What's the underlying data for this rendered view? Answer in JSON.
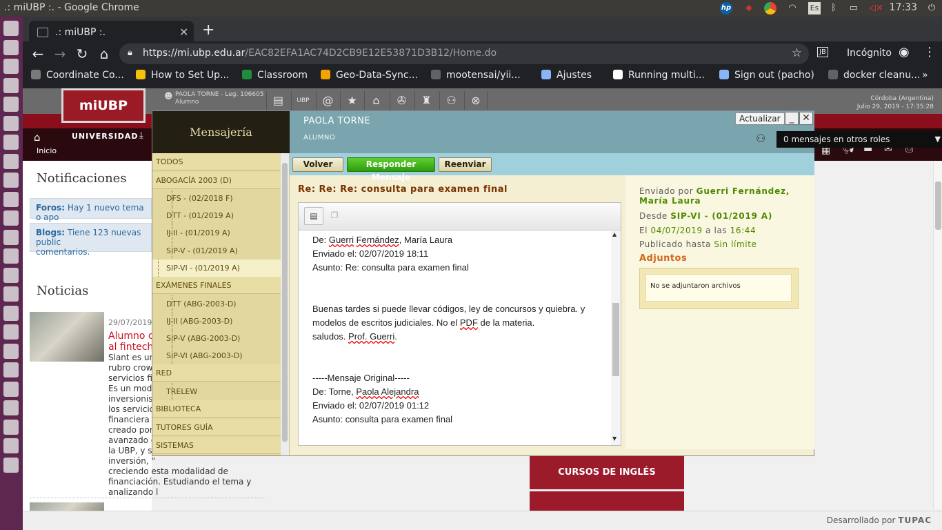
{
  "os": {
    "window_title": ".: miUBP :. - Google Chrome",
    "clock": "17:33",
    "keyboard": "Es",
    "dock_icons": [
      "settings-icon",
      "files-icon",
      "firefox-icon",
      "chrome-icon",
      "docs-icon",
      "amazon-icon",
      "calendar-icon",
      "store-icon",
      "image-icon",
      "presentation-icon",
      "spreadsheet-icon",
      "box-icon",
      "printer-icon",
      "vscode-icon",
      "cube-icon",
      "mail-icon",
      "hp-icon",
      "terminal-icon",
      "network-icon",
      "shield-icon",
      "word-icon",
      "usb-icon",
      "calc-icon",
      "trash-icon"
    ]
  },
  "browser": {
    "tab_title": ".: miUBP :.",
    "url_host": "https://mi.ubp.edu.ar",
    "url_path": "/EAC82EFA1AC74D2CB9E12E53871D3B12/Home.do",
    "incognito_label": "Incógnito",
    "extension_label": "JB",
    "bookmarks": [
      {
        "label": "Coordinate Co...",
        "color": "#7a7a7a"
      },
      {
        "label": "How to Set Up...",
        "color": "#f4c20d"
      },
      {
        "label": "Classroom",
        "color": "#1e8e3e"
      },
      {
        "label": "Geo-Data-Sync...",
        "color": "#f4a300"
      },
      {
        "label": "mootensai/yii...",
        "color": "#5f6368"
      },
      {
        "label": "Ajustes",
        "color": "#8ab4f8"
      },
      {
        "label": "Running multi...",
        "color": "#ffffff"
      },
      {
        "label": "Sign out (pacho)",
        "color": "#8ab4f8"
      },
      {
        "label": "docker cleanu...",
        "color": "#5f6368"
      }
    ]
  },
  "site": {
    "logo": "miUBP",
    "user_name": "PAOLA TORNE - Leg. 106605",
    "user_role": "Alumno",
    "location": "Córdoba (Argentina)",
    "datetime": "Julio 29, 2019 - 17:35:28",
    "nav_university": "UNIVERSIDAD",
    "nav_home": "Inicio",
    "notifications_title": "Notificaciones",
    "forum_label": "Foros:",
    "forum_text": "Hay 1 nuevo tema o apo",
    "blogs_label": "Blogs:",
    "blogs_text": "Tiene 123 nuevas public",
    "blogs_text2": "comentarios.",
    "news_title": "Noticias",
    "news_date": "29/07/2019",
    "news_headline1": "Alumno cr",
    "news_headline2": "al fintech",
    "news_lines": [
      "Slant es una",
      "rubro crowd",
      "servicios fin",
      "Es un model",
      "inversionist",
      "los servicios",
      "financiera t",
      "creado por",
      "avanzado d",
      "la UBP, y su",
      "inversión, \"",
      "creciendo esta modalidad de",
      "financiación. Estudiando el tema y",
      "analizando l"
    ],
    "banner_english": "CURSOS DE INGLÉS",
    "developed_by": "Desarrollado por",
    "developer": "TUPAC"
  },
  "messaging": {
    "title": "Mensajería",
    "sender_header_name": "PAOLA TORNE",
    "sender_header_role": "ALUMNO",
    "update_button": "Actualizar",
    "roles_select": "0  mensajes en otros roles",
    "buttons": {
      "back": "Volver",
      "reply": "Responder Mensaje",
      "forward": "Reenviar"
    },
    "folders": [
      {
        "label": "TODOS",
        "type": "cat"
      },
      {
        "label": "ABOGACÍA 2003 (D)",
        "type": "cat"
      },
      {
        "label": "DFS - (02/2018 F)",
        "type": "sub"
      },
      {
        "label": "DTT - (01/2019 A)",
        "type": "sub"
      },
      {
        "label": "IJ-II - (01/2019 A)",
        "type": "sub"
      },
      {
        "label": "SIP-V - (01/2019 A)",
        "type": "sub"
      },
      {
        "label": "SIP-VI - (01/2019 A)",
        "type": "sub",
        "selected": true
      },
      {
        "label": "EXÁMENES FINALES",
        "type": "cat"
      },
      {
        "label": "DTT (ABG-2003-D)",
        "type": "sub"
      },
      {
        "label": "IJ-II (ABG-2003-D)",
        "type": "sub"
      },
      {
        "label": "SIP-V (ABG-2003-D)",
        "type": "sub"
      },
      {
        "label": "SIP-VI (ABG-2003-D)",
        "type": "sub"
      },
      {
        "label": "RED",
        "type": "cat"
      },
      {
        "label": "TRELEW",
        "type": "sub"
      },
      {
        "label": "BIBLIOTECA",
        "type": "cat"
      },
      {
        "label": "TUTORES GUÍA",
        "type": "cat"
      },
      {
        "label": "SISTEMAS",
        "type": "cat"
      }
    ],
    "subject": "Re: Re: Re: consulta para examen final",
    "body": {
      "l1_pre": "De: ",
      "l1_a": "Guerri",
      "l1_sp": " ",
      "l1_b": "Fernández",
      "l1_post": ", María Laura",
      "l2": "Enviado el: 02/07/2019 18:11",
      "l3": "Asunto: Re: consulta para examen final",
      "l4": "Buenas tardes si puede llevar códigos, ley de concursos y quiebra. y",
      "l5_pre": "modelos de escritos judiciales. No el ",
      "l5_ul": "PDF",
      "l5_post": " de la materia.",
      "l6_pre": "saludos. ",
      "l6_ul": "Prof. Guerri",
      "l6_post": ".",
      "l7": "-----Mensaje Original-----",
      "l8_pre": "De: Torne, ",
      "l8_ul": "Paola Alejandra",
      "l9": "Enviado el: 02/07/2019 01:12",
      "l10": "Asunto: consulta para examen final"
    },
    "meta": {
      "sent_by_label": "Enviado por",
      "sent_by": "Guerri Fernández,",
      "sent_by2": "María Laura",
      "from_label": "Desde",
      "from": "SIP-VI - (01/2019 A)",
      "date_label": "El",
      "date": "04/07/2019",
      "at_label": "a las",
      "time": "16:44",
      "published_label": "Publicado hasta",
      "published": "Sin límite",
      "attachments_title": "Adjuntos",
      "no_attachments": "No se adjuntaron archivos"
    }
  }
}
